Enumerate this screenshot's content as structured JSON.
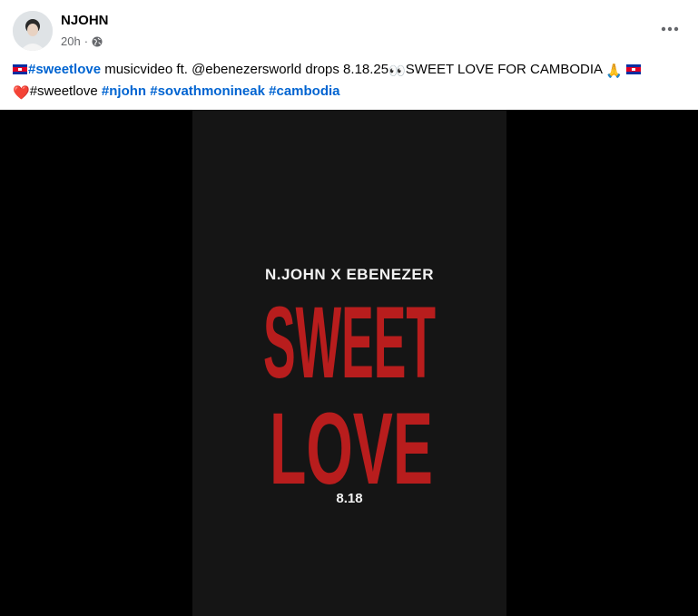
{
  "post": {
    "author": "NJOHN",
    "time": "20h",
    "separator": "·",
    "privacy_icon": "globe-icon",
    "more_icon": "more-options-icon"
  },
  "caption": {
    "hashtag_sweetlove_1": "#sweetlove",
    "text_1": " musicvideo ft. @ebenezersworld drops 8.18.25",
    "eyes_emoji": "👀",
    "text_2": "SWEET LOVE FOR CAMBODIA ",
    "pray_emoji": "🙏",
    "heart_emoji": "❤️",
    "plain_sweetlove": "#sweetlove ",
    "hashtag_njohn": "#njohn",
    "hashtag_sovathmonineak": "#sovathmonineak",
    "hashtag_cambodia": "#cambodia"
  },
  "poster": {
    "credit": "N.JOHN X EBENEZER",
    "title_line1": "SWEET",
    "title_line2": "LOVE",
    "date": "8.18",
    "title_color": "#b81d1d",
    "background_color": "#151515"
  }
}
